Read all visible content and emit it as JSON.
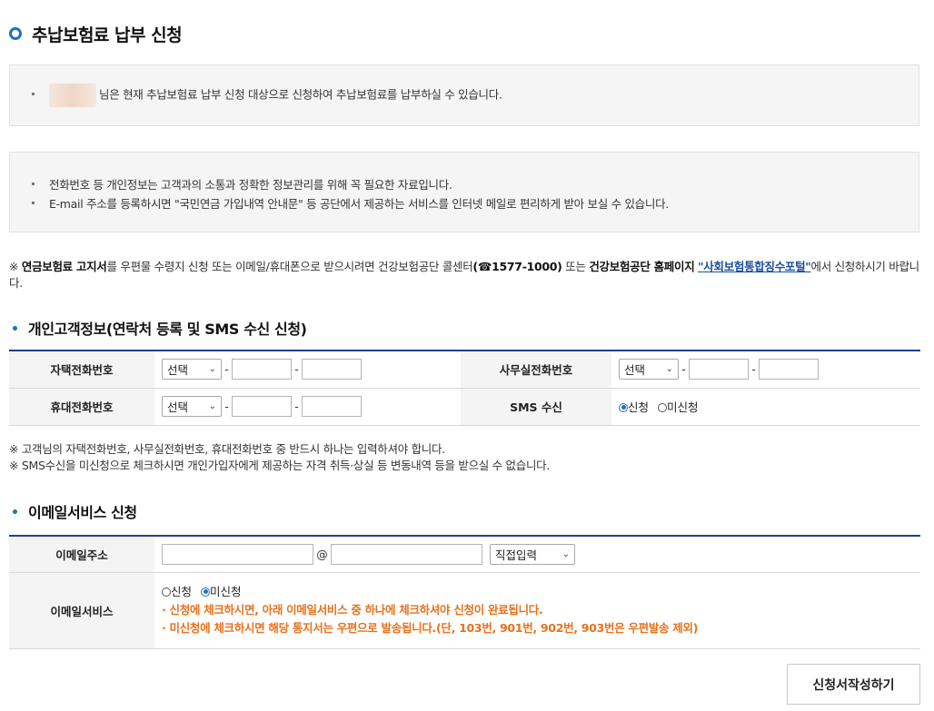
{
  "page": {
    "title": "추납보험료 납부 신청"
  },
  "notice": {
    "eligibility": "님은 현재 추납보험료 납부 신청 대상으로 신청하여 추납보험료를 납부하실 수 있습니다.",
    "privacy_lines": [
      "전화번호 등 개인정보는 고객과의 소통과 정확한 정보관리를 위해 꼭 필요한 자료입니다.",
      "E-mail 주소를 등록하시면 \"국민연금 가입내역 안내문\" 등 공단에서 제공하는 서비스를 인터넷 메일로 편리하게 받아 보실 수 있습니다."
    ]
  },
  "main_note": {
    "prefix": "※ ",
    "bold1": "연금보험료 고지서",
    "text1": "를 우편물 수령지 신청 또는 이메일/휴대폰으로 받으시려면 건강보험공단 콜센터",
    "bold2": "(☎1577-1000)",
    "text2": " 또는 ",
    "bold3": "건강보험공단 홈페이지",
    "link": "\"사회보험통합징수포털\"",
    "text3": "에서 신청하시기 바랍니다."
  },
  "section1": {
    "title": "개인고객정보(연락처 등록 및 SMS 수신 신청)",
    "home_phone_label": "자택전화번호",
    "office_phone_label": "사무실전화번호",
    "mobile_label": "휴대전화번호",
    "sms_label": "SMS 수신",
    "select_placeholder": "선택",
    "sms_options": [
      "신청",
      "미신청"
    ],
    "sms_selected": "신청",
    "notes": [
      "※ 고객님의 자택전화번호, 사무실전화번호, 휴대전화번호 중 반드시 하나는 입력하셔야 합니다.",
      "※ SMS수신을 미신청으로 체크하시면 개인가입자에게 제공하는 자격 취득·상실 등 변동내역 등을 받으실 수 없습니다."
    ]
  },
  "section2": {
    "title": "이메일서비스 신청",
    "email_label": "이메일주소",
    "email_at": "@",
    "domain_select": "직접입력",
    "service_label": "이메일서비스",
    "service_options": [
      "신청",
      "미신청"
    ],
    "service_selected": "미신청",
    "warnings": [
      "· 신청에 체크하시면, 아래 이메일서비스 중 하나에 체크하셔야 신청이 완료됩니다.",
      "· 미신청에 체크하시면 해당 통지서는 우편으로 발송됩니다.(단, 103번, 901번, 902번, 903번은 우편발송 제외)"
    ]
  },
  "actions": {
    "submit": "신청서작성하기"
  },
  "colors": {
    "accent": "#1f6fc4",
    "table_border": "#1f3f8f",
    "warning": "#e8711c"
  }
}
